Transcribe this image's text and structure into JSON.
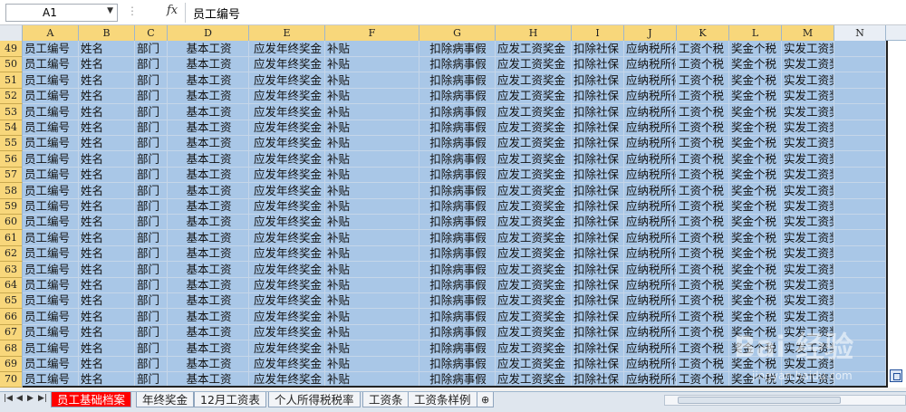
{
  "formula_bar": {
    "name_box": "A1",
    "formula_value": "员工编号"
  },
  "columns": [
    "A",
    "B",
    "C",
    "D",
    "E",
    "F",
    "G",
    "H",
    "I",
    "J",
    "K",
    "L",
    "M",
    "N"
  ],
  "row_numbers": [
    "49",
    "50",
    "51",
    "52",
    "53",
    "54",
    "55",
    "56",
    "57",
    "58",
    "59",
    "60",
    "61",
    "62",
    "63",
    "64",
    "65",
    "66",
    "67",
    "68",
    "69",
    "70"
  ],
  "row_values": [
    "员工编号",
    "姓名",
    "部门",
    "基本工资",
    "应发年终奖金",
    "补贴",
    "扣除病事假",
    "应发工资奖金",
    "扣除社保",
    "应纳税所得",
    "工资个税",
    "奖金个税",
    "实发工资奖金",
    ""
  ],
  "sheet_tabs": [
    {
      "label": "员工基础档案",
      "active": true
    },
    {
      "label": "年终奖金",
      "active": false
    },
    {
      "label": "12月工资表",
      "active": false
    },
    {
      "label": "个人所得税税率",
      "active": false
    },
    {
      "label": "工资条",
      "active": false
    },
    {
      "label": "工资条样例",
      "active": false
    }
  ],
  "watermark": {
    "text": "Bai 经验",
    "url": "jingyan.baidu.com"
  }
}
